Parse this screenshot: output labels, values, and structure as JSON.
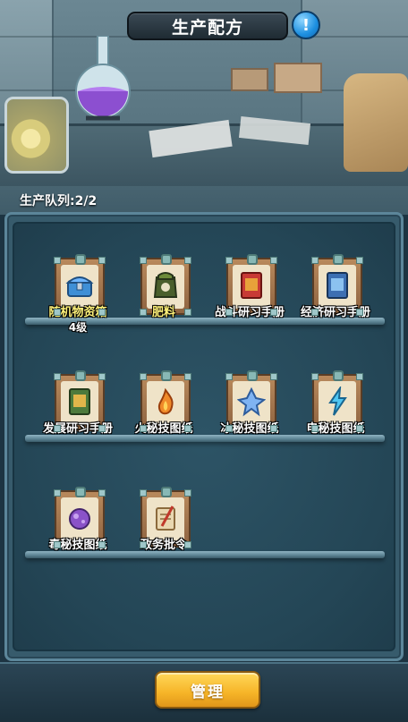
{
  "header": {
    "title": "生产配方",
    "info_icon": "info-icon",
    "info_glyph": "!"
  },
  "queue": {
    "label": "生产队列:2/2"
  },
  "recipes": [
    {
      "name": "随机物资箱",
      "sub": "4级",
      "icon": "chest-icon",
      "highlight": true
    },
    {
      "name": "肥料",
      "icon": "fertilizer-sack-icon",
      "highlight": true
    },
    {
      "name": "战斗研习手册",
      "icon": "red-book-icon",
      "highlight": false
    },
    {
      "name": "经济研习手册",
      "icon": "blue-book-icon",
      "highlight": false
    },
    {
      "name": "发展研习手册",
      "icon": "green-book-icon",
      "highlight": false
    },
    {
      "name": "火秘技图纸",
      "icon": "fire-blueprint-icon",
      "highlight": false
    },
    {
      "name": "冰秘技图纸",
      "icon": "ice-blueprint-icon",
      "highlight": false
    },
    {
      "name": "电秘技图纸",
      "icon": "lightning-blueprint-icon",
      "highlight": false
    },
    {
      "name": "毒秘技图纸",
      "icon": "poison-blueprint-icon",
      "highlight": false
    },
    {
      "name": "政务批令",
      "icon": "scroll-quill-icon",
      "highlight": false
    }
  ],
  "footer": {
    "manage_label": "管理"
  },
  "colors": {
    "highlight_label": "#fff27a",
    "button": "#f6b427",
    "panel": "#375b6c"
  }
}
